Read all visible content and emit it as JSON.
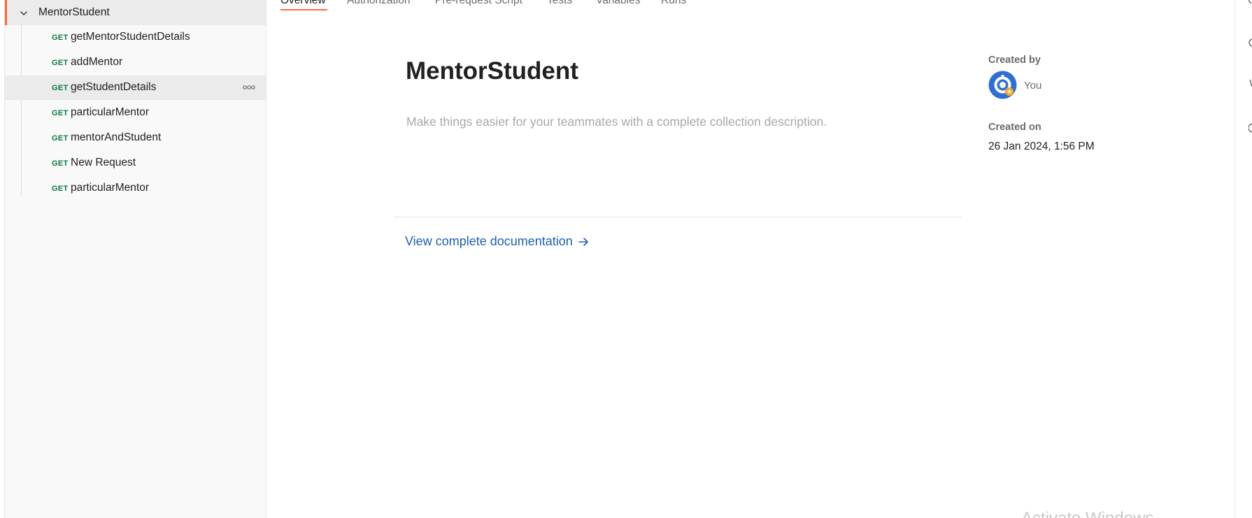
{
  "sidebar": {
    "collection": {
      "name": "MentorStudent",
      "expanded": true
    },
    "requests": [
      {
        "method": "GET",
        "name": "getMentorStudentDetails",
        "active": false
      },
      {
        "method": "GET",
        "name": "addMentor",
        "active": false
      },
      {
        "method": "GET",
        "name": "getStudentDetails",
        "active": true
      },
      {
        "method": "GET",
        "name": "particularMentor",
        "active": false
      },
      {
        "method": "GET",
        "name": "mentorAndStudent",
        "active": false
      },
      {
        "method": "GET",
        "name": "New Request",
        "active": false
      },
      {
        "method": "GET",
        "name": "particularMentor",
        "active": false
      }
    ]
  },
  "tabs": [
    {
      "label": "Overview",
      "active": true
    },
    {
      "label": "Authorization",
      "active": false
    },
    {
      "label": "Pre-request Script",
      "active": false
    },
    {
      "label": "Tests",
      "active": false
    },
    {
      "label": "Variables",
      "active": false
    },
    {
      "label": "Runs",
      "active": false
    }
  ],
  "overview": {
    "title": "MentorStudent",
    "description_placeholder": "Make things easier for your teammates with a complete collection description.",
    "docs_link": "View complete documentation"
  },
  "meta": {
    "created_by_label": "Created by",
    "created_by_value": "You",
    "created_on_label": "Created on",
    "created_on_value": "26 Jan 2024, 1:56 PM"
  },
  "watermark": "Activate Windows",
  "colors": {
    "accent": "#ff6c37",
    "get_method": "#0a7b3e",
    "link": "#1d5fb0",
    "avatar_blue": "#2f6fd1"
  },
  "icons": {
    "collapse": "chevron-down-icon",
    "more": "more-horizontal-icon",
    "arrow": "arrow-right-icon",
    "avatar": "user-avatar"
  }
}
